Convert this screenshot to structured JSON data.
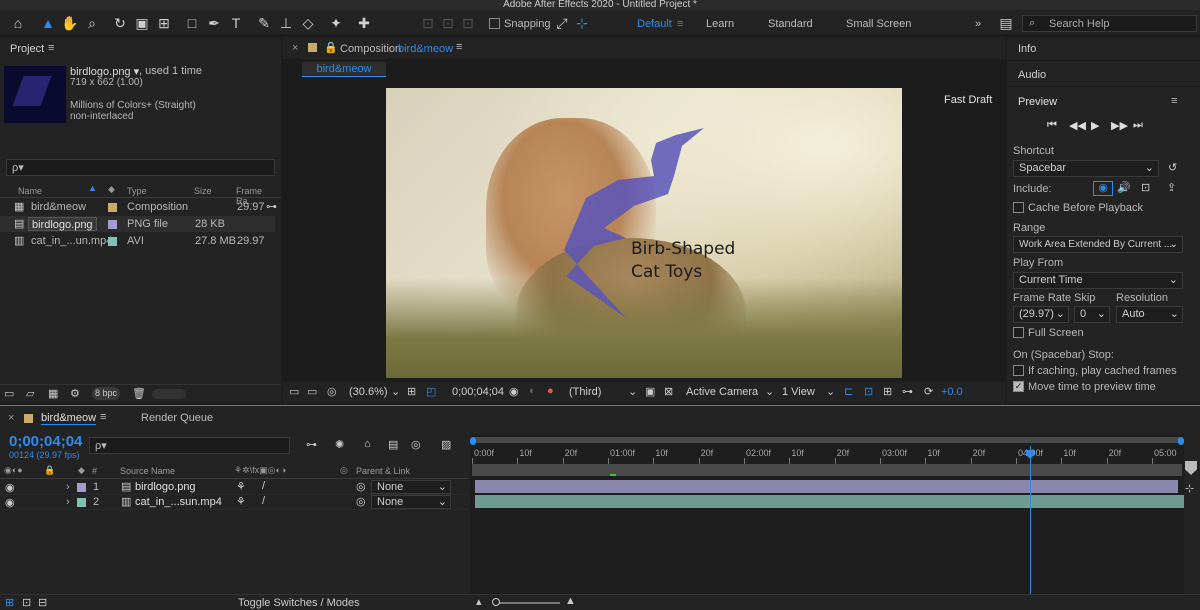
{
  "window": {
    "title": "Adobe After Effects 2020 - Untitled Project *"
  },
  "toolbar": {
    "snapping": "Snapping",
    "workspaces": [
      "Default",
      "Learn",
      "Standard",
      "Small Screen"
    ],
    "search_placeholder": "Search Help"
  },
  "project": {
    "title": "Project",
    "selected": {
      "name": "birdlogo.png ▾",
      "usage": ", used 1 time",
      "dims": "719 x 662 (1.00)",
      "colors": "Millions of Colors+ (Straight)",
      "interlace": "non-interlaced"
    },
    "search_placeholder": "ρ▾",
    "columns": {
      "name": "Name",
      "type": "Type",
      "size": "Size",
      "fps": "Frame Ra..."
    },
    "items": [
      {
        "name": "bird&meow",
        "type": "Composition",
        "size": "",
        "fps": "29.97",
        "color": "#c9ab6b"
      },
      {
        "name": "birdlogo.png",
        "type": "PNG file",
        "size": "28 KB",
        "fps": "",
        "color": "#a49bd1"
      },
      {
        "name": "cat_in_...un.mp4",
        "type": "AVI",
        "size": "27.8 MB",
        "fps": "29.97",
        "color": "#7fc2b5"
      }
    ],
    "bpc": "8 bpc"
  },
  "composition": {
    "header_prefix": "Composition",
    "header_name": "bird&meow",
    "tab": "bird&meow",
    "fast_draft": "Fast Draft",
    "logo_line1": "Birb-Shaped",
    "logo_line2": "Cat Toys",
    "footer": {
      "zoom": "(30.6%)",
      "timecode": "0;00;04;04",
      "resolution": "(Third)",
      "camera": "Active Camera",
      "views": "1 View",
      "exposure": "+0.0"
    }
  },
  "right": {
    "info": "Info",
    "audio": "Audio",
    "preview": "Preview",
    "shortcut_label": "Shortcut",
    "shortcut": "Spacebar",
    "include_label": "Include:",
    "cache_before": "Cache Before Playback",
    "range_label": "Range",
    "range": "Work Area Extended By Current ...",
    "play_from_label": "Play From",
    "play_from": "Current Time",
    "frame_rate_label": "Frame Rate",
    "frame_rate": "(29.97)",
    "skip_label": "Skip",
    "skip": "0",
    "resolution_label": "Resolution",
    "resolution": "Auto",
    "full_screen": "Full Screen",
    "on_spacebar": "On (Spacebar) Stop:",
    "if_caching": "If caching, play cached frames",
    "move_time": "Move time to preview time",
    "move_time_checked": true
  },
  "timeline": {
    "tab": "bird&meow",
    "render_queue": "Render Queue",
    "timecode": "0;00;04;04",
    "frame_info": "00124 (29.97 fps)",
    "col_num": "#",
    "col_source": "Source Name",
    "col_parent": "Parent & Link",
    "layers": [
      {
        "num": "1",
        "name": "birdlogo.png",
        "parent": "None",
        "color": "#a49bd1",
        "bar": "#8c87ac"
      },
      {
        "num": "2",
        "name": "cat_in_...sun.mp4",
        "parent": "None",
        "color": "#7fc2b5",
        "bar": "#6e9b92"
      }
    ],
    "ruler": [
      "0:00f",
      "10f",
      "20f",
      "01:00f",
      "10f",
      "20f",
      "02:00f",
      "10f",
      "20f",
      "03:00f",
      "10f",
      "20f",
      "04:00f",
      "10f",
      "20f",
      "05:00"
    ],
    "playhead_fraction": 0.82,
    "toggle": "Toggle Switches / Modes"
  }
}
